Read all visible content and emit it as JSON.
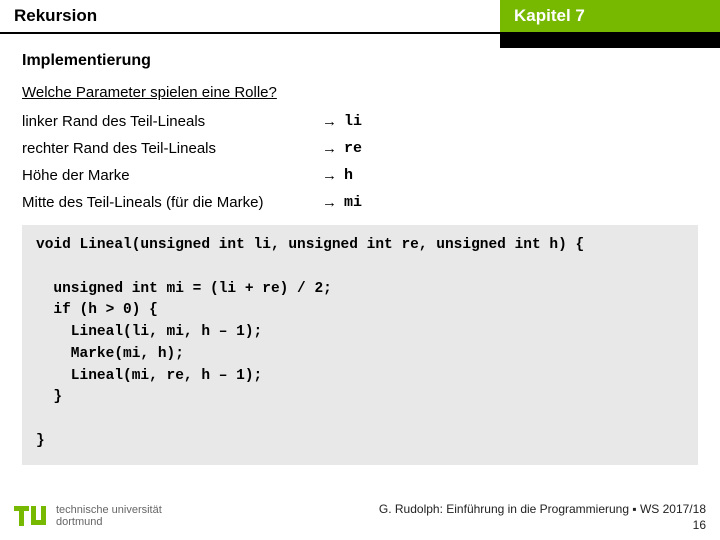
{
  "header": {
    "left": "Rekursion",
    "right": "Kapitel 7"
  },
  "section_title": "Implementierung",
  "question": "Welche Parameter spielen eine Rolle?",
  "params": [
    {
      "desc": "linker Rand des Teil-Lineals",
      "arrow": "→",
      "var": "li"
    },
    {
      "desc": "rechter Rand des Teil-Lineals",
      "arrow": "→",
      "var": "re"
    },
    {
      "desc": "Höhe der Marke",
      "arrow": "→",
      "var": "h"
    },
    {
      "desc": "Mitte des Teil-Lineals (für die Marke)",
      "arrow": "→",
      "var": "mi"
    }
  ],
  "code": "void Lineal(unsigned int li, unsigned int re, unsigned int h) {\n\n  unsigned int mi = (li + re) / 2;\n  if (h > 0) {\n    Lineal(li, mi, h – 1);\n    Marke(mi, h);\n    Lineal(mi, re, h – 1);\n  }\n\n}",
  "logo": {
    "line1": "technische universität",
    "line2": "dortmund"
  },
  "credit": {
    "line": "G. Rudolph: Einführung in die Programmierung ▪ WS 2017/18",
    "page": "16"
  }
}
